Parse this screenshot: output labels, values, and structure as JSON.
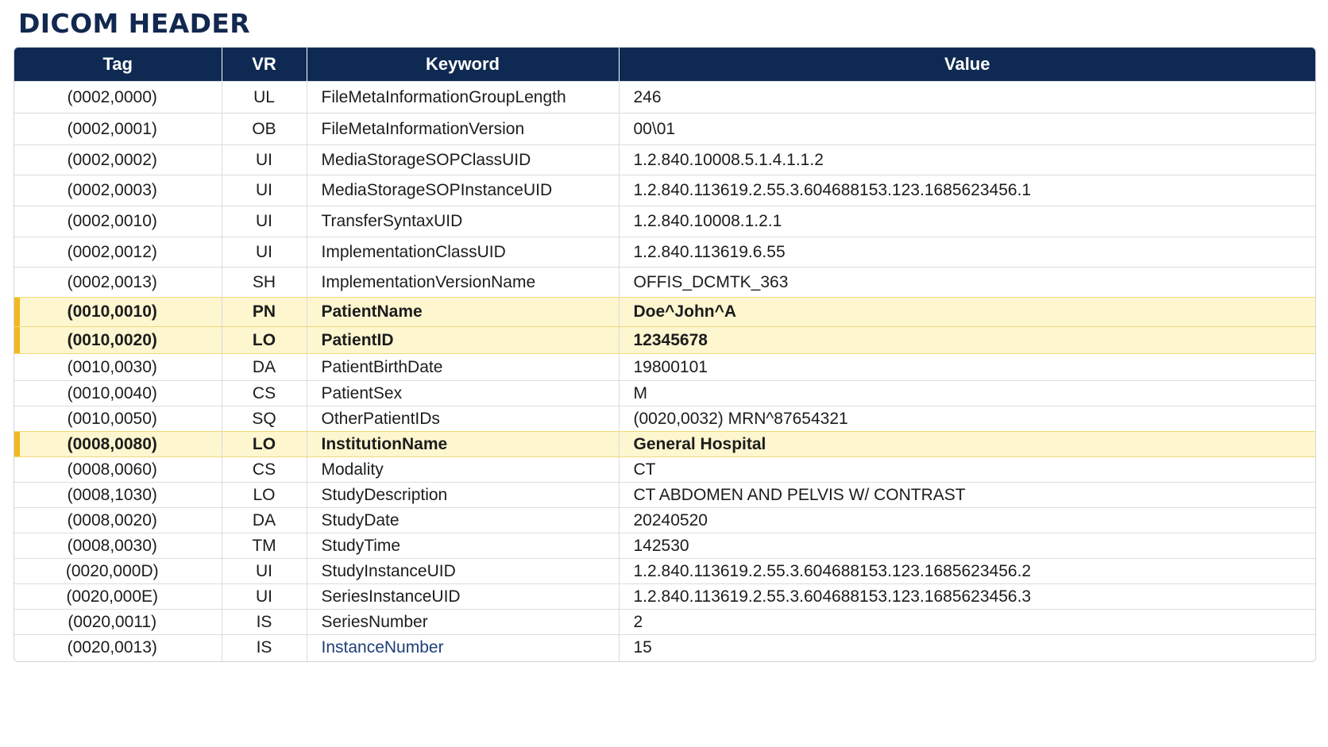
{
  "title": "DICOM HEADER",
  "columns": [
    "Tag",
    "VR",
    "Keyword",
    "Value"
  ],
  "colors": {
    "header_bg": "#0f2a52",
    "title": "#12284f",
    "highlight_bg": "#fdf6cf",
    "highlight_bar": "#f3b820"
  },
  "rows": [
    {
      "tag": "(0002,0000)",
      "vr": "UL",
      "keyword": "FileMetaInformationGroupLength",
      "value": "246",
      "highlight": false
    },
    {
      "tag": "(0002,0001)",
      "vr": "OB",
      "keyword": "FileMetaInformationVersion",
      "value": "00\\01",
      "highlight": false
    },
    {
      "tag": "(0002,0002)",
      "vr": "UI",
      "keyword": "MediaStorageSOPClassUID",
      "value": "1.2.840.10008.5.1.4.1.1.2",
      "highlight": false
    },
    {
      "tag": "(0002,0003)",
      "vr": "UI",
      "keyword": "MediaStorageSOPInstanceUID",
      "value": "1.2.840.113619.2.55.3.604688153.123.1685623456.1",
      "highlight": false
    },
    {
      "tag": "(0002,0010)",
      "vr": "UI",
      "keyword": "TransferSyntaxUID",
      "value": "1.2.840.10008.1.2.1",
      "highlight": false
    },
    {
      "tag": "(0002,0012)",
      "vr": "UI",
      "keyword": "ImplementationClassUID",
      "value": "1.2.840.113619.6.55",
      "highlight": false
    },
    {
      "tag": "(0002,0013)",
      "vr": "SH",
      "keyword": "ImplementationVersionName",
      "value": "OFFIS_DCMTK_363",
      "highlight": false
    },
    {
      "tag": "(0010,0010)",
      "vr": "PN",
      "keyword": "PatientName",
      "value": "Doe^John^A",
      "highlight": true
    },
    {
      "tag": "(0010,0020)",
      "vr": "LO",
      "keyword": "PatientID",
      "value": "12345678",
      "highlight": true
    },
    {
      "tag": "(0010,0030)",
      "vr": "DA",
      "keyword": "PatientBirthDate",
      "value": "19800101",
      "highlight": false
    },
    {
      "tag": "(0010,0040)",
      "vr": "CS",
      "keyword": "PatientSex",
      "value": "M",
      "highlight": false
    },
    {
      "tag": "(0010,0050)",
      "vr": "SQ",
      "keyword": "OtherPatientIDs",
      "value": "(0020,0032) MRN^87654321",
      "highlight": false
    },
    {
      "tag": "(0008,0080)",
      "vr": "LO",
      "keyword": "InstitutionName",
      "value": "General Hospital",
      "highlight": true
    },
    {
      "tag": "(0008,0060)",
      "vr": "CS",
      "keyword": "Modality",
      "value": "CT",
      "highlight": false
    },
    {
      "tag": "(0008,1030)",
      "vr": "LO",
      "keyword": "StudyDescription",
      "value": "CT ABDOMEN AND PELVIS W/ CONTRAST",
      "highlight": false
    },
    {
      "tag": "(0008,0020)",
      "vr": "DA",
      "keyword": "StudyDate",
      "value": "20240520",
      "highlight": false
    },
    {
      "tag": "(0008,0030)",
      "vr": "TM",
      "keyword": "StudyTime",
      "value": "142530",
      "highlight": false
    },
    {
      "tag": "(0020,000D)",
      "vr": "UI",
      "keyword": "StudyInstanceUID",
      "value": "1.2.840.113619.2.55.3.604688153.123.1685623456.2",
      "highlight": false
    },
    {
      "tag": "(0020,000E)",
      "vr": "UI",
      "keyword": "SeriesInstanceUID",
      "value": "1.2.840.113619.2.55.3.604688153.123.1685623456.3",
      "highlight": false
    },
    {
      "tag": "(0020,0011)",
      "vr": "IS",
      "keyword": "SeriesNumber",
      "value": "2",
      "highlight": false
    },
    {
      "tag": "(0020,0013)",
      "vr": "IS",
      "keyword": "InstanceNumber",
      "value": "15",
      "highlight": false,
      "keyword_link": true
    }
  ]
}
